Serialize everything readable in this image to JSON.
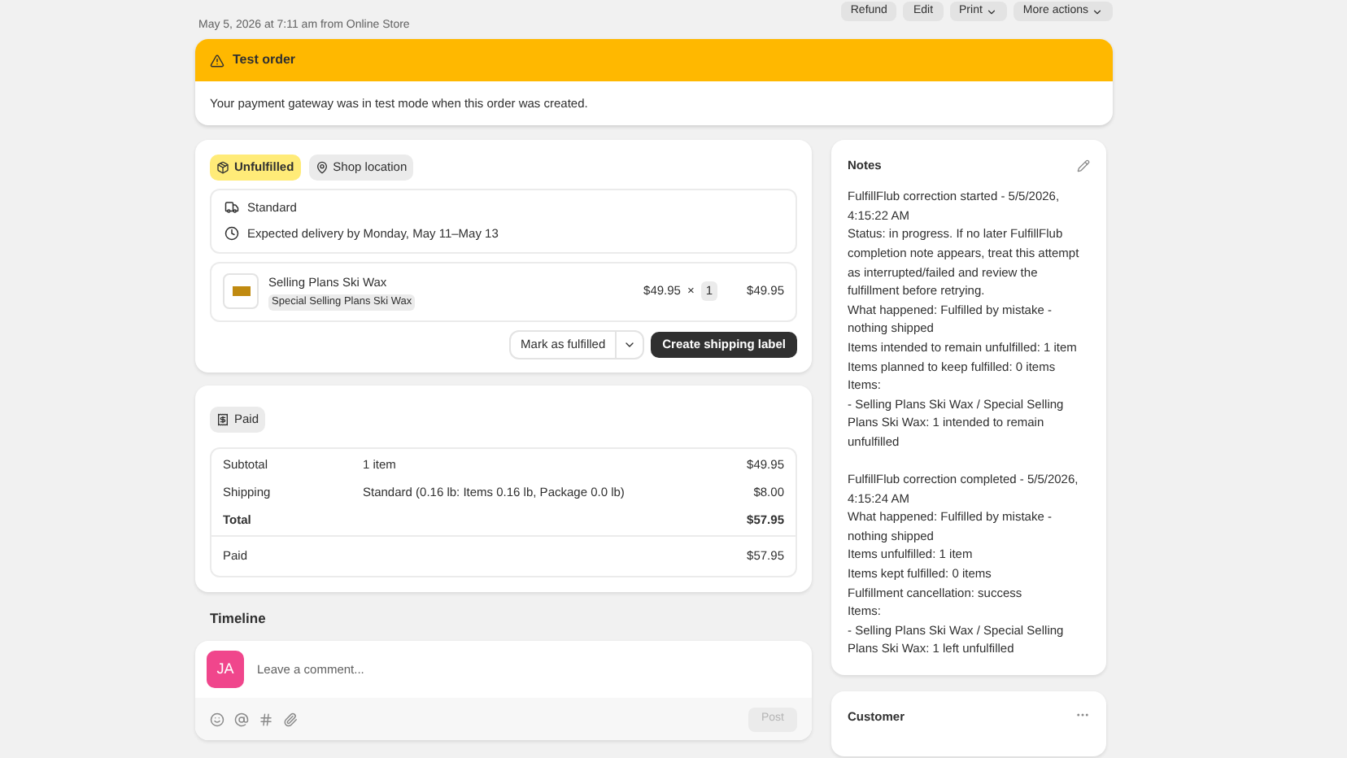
{
  "header": {
    "subtitle": "May 5, 2026 at 7:11 am from Online Store",
    "actions": [
      {
        "label": "Refund",
        "dropdown": false
      },
      {
        "label": "Edit",
        "dropdown": false
      },
      {
        "label": "Print",
        "dropdown": true
      },
      {
        "label": "More actions",
        "dropdown": true
      }
    ]
  },
  "banner": {
    "title": "Test order",
    "message": "Your payment gateway was in test mode when this order was created."
  },
  "fulfillment": {
    "status": "Unfulfilled",
    "location": "Shop location",
    "method": "Standard",
    "delivery": "Expected delivery by Monday, May 11–May 13",
    "items": [
      {
        "name": "Selling Plans Ski Wax",
        "variant": "Special Selling Plans Ski Wax",
        "price": "$49.95",
        "times": "×",
        "quantity": "1",
        "total": "$49.95"
      }
    ],
    "secondary_button": "Mark as fulfilled",
    "primary_button": "Create shipping label"
  },
  "payment": {
    "status": "Paid",
    "rows": [
      {
        "label": "Subtotal",
        "detail": "1 item",
        "amount": "$49.95",
        "bold": false
      },
      {
        "label": "Shipping",
        "detail": "Standard (0.16 lb: Items 0.16 lb, Package 0.0 lb)",
        "amount": "$8.00",
        "bold": false
      },
      {
        "label": "Total",
        "amount": "$57.95",
        "bold": true
      }
    ],
    "paid": {
      "label": "Paid",
      "amount": "$57.95"
    }
  },
  "timeline": {
    "title": "Timeline",
    "avatar": "JA",
    "placeholder": "Leave a comment...",
    "post_button": "Post"
  },
  "notes": {
    "title": "Notes",
    "blocks": [
      [
        "FulfillFlub correction started - 5/5/2026, 4:15:22 AM",
        "Status: in progress. If no later FulfillFlub completion note appears, treat this attempt as interrupted/failed and review the fulfillment before retrying.",
        "What happened: Fulfilled by mistake - nothing shipped",
        "Items intended to remain unfulfilled: 1 item",
        "Items planned to keep fulfilled: 0 items",
        "Items:",
        "- Selling Plans Ski Wax / Special Selling Plans Ski Wax: 1 intended to remain unfulfilled"
      ],
      [
        "FulfillFlub correction completed - 5/5/2026, 4:15:24 AM",
        "What happened: Fulfilled by mistake - nothing shipped",
        "Items unfulfilled: 1 item",
        "Items kept fulfilled: 0 items",
        "Fulfillment cancellation: success",
        "Items:",
        "- Selling Plans Ski Wax / Special Selling Plans Ski Wax: 1 left unfulfilled"
      ]
    ]
  },
  "customer": {
    "title": "Customer"
  }
}
